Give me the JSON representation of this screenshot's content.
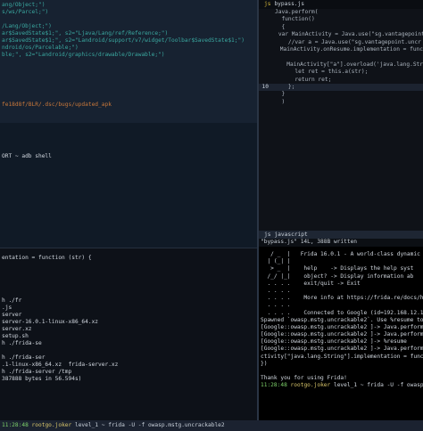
{
  "top_left": {
    "lines": [
      {
        "text": "ang/Object;\")",
        "color": "c-path"
      },
      {
        "text": "s/ws/Parcel;\")",
        "color": "c-path"
      },
      {
        "text": "",
        "color": "c-path"
      },
      {
        "text": "/Lang/Object;\")",
        "color": "c-path"
      },
      {
        "text": "ar$SavedState$1;\", s2=\"Ljava/Lang/ref/Reference;\")",
        "color": "c-path"
      },
      {
        "text": "ar$SavedState$1;\", s2=\"Landroid/support/v7/widget/Toolbar$SavedState$1;\")",
        "color": "c-path"
      },
      {
        "text": "ndroid/os/Parcelable;\")",
        "color": "c-path"
      },
      {
        "text": "ble;\", s2=\"Landroid/graphics/drawable/Drawable;\")",
        "color": "c-path"
      },
      {
        "text": "",
        "color": "c-path"
      },
      {
        "text": "",
        "color": "c-path"
      },
      {
        "text": "",
        "color": "c-path"
      },
      {
        "text": "",
        "color": "c-path"
      },
      {
        "text": "",
        "color": "c-path"
      },
      {
        "text": "",
        "color": "c-path"
      },
      {
        "text": "fe18d8f/BLR/.dsc/bugs/updated_apk",
        "color": "c-orange"
      }
    ]
  },
  "middle_left": {
    "lines": [
      {
        "text": "",
        "color": "c-grey"
      },
      {
        "text": "",
        "color": "c-grey"
      },
      {
        "text": "",
        "color": "c-grey"
      },
      {
        "text": "",
        "color": "c-grey"
      },
      {
        "text": "ORT ~ adb shell",
        "color": "c-white"
      }
    ]
  },
  "bottom_left": {
    "lines": [
      {
        "text": "",
        "color": "c-white"
      },
      {
        "text": "entation = function (str) {",
        "color": "c-white"
      },
      {
        "text": "",
        "color": "c-white"
      },
      {
        "text": "",
        "color": "c-white"
      },
      {
        "text": "",
        "color": "c-white"
      },
      {
        "text": "",
        "color": "c-white"
      },
      {
        "text": "",
        "color": "c-white"
      },
      {
        "text": "h ./fr",
        "color": "c-white"
      },
      {
        "text": ".js",
        "color": "c-white"
      },
      {
        "text": "server",
        "color": "c-white"
      },
      {
        "text": "server-16.0.1-linux-x86_64.xz",
        "color": "c-white"
      },
      {
        "text": "server.xz",
        "color": "c-white"
      },
      {
        "text": "setup.sh",
        "color": "c-white"
      },
      {
        "text": "h ./frida-se",
        "color": "c-white"
      },
      {
        "text": "",
        "color": "c-white"
      },
      {
        "text": "h ./frida-ser",
        "color": "c-white"
      },
      {
        "text": ".1-linux-x86_64.xz  frida-server.xz",
        "color": "c-white"
      },
      {
        "text": "h ./frida-server /tmp",
        "color": "c-white"
      },
      {
        "text": "387888 bytes in 56.594s)",
        "color": "c-white"
      }
    ]
  },
  "editor": {
    "tab_icon": "js",
    "tab_name": "bypass.js",
    "mode_icon": "js",
    "mode_name": "javascript",
    "status_file": "\"bypass.js\" 14L, 388B written",
    "lines": [
      {
        "num": "",
        "html_key": "l1"
      },
      {
        "num": "",
        "html_key": "l2"
      },
      {
        "num": "",
        "html_key": "l3"
      },
      {
        "num": "",
        "html_key": "l4"
      },
      {
        "num": "",
        "html_key": "l5"
      },
      {
        "num": "",
        "html_key": "l6"
      },
      {
        "num": "",
        "html_key": "l7"
      },
      {
        "num": "",
        "html_key": "l8"
      },
      {
        "num": "",
        "html_key": "l9"
      },
      {
        "num": "",
        "html_key": "l10"
      },
      {
        "num": "10",
        "html_key": "l11"
      },
      {
        "num": "",
        "html_key": "l12"
      },
      {
        "num": "",
        "html_key": "l13"
      },
      {
        "num": "",
        "html_key": "l14"
      }
    ],
    "code": {
      "l1": "Java.perform(",
      "l2": "  function()",
      "l3": "  {",
      "l4": "    var MainActivity = Java.use(\"sg.vantagepoint",
      "l5": "    //var a = Java.use(\"sg.vantagepoint.uncr",
      "l6": "    MainActivity.onResume.implementation = func",
      "l7": "",
      "l8": "      MainActivity[\"a\"].overload('java.lang.Str",
      "l9": "      let ret = this.a(str);",
      "l10": "      return ret;",
      "l11": "    };",
      "l12": "  }",
      "l13": "  )",
      "l14": ""
    }
  },
  "frida": {
    "logo": [
      "   / _  |   Frida 16.0.1 - A world-class dynamic",
      "  | (_| |",
      "   > _  |    help    -> Displays the help syst",
      "  /_/ |_|    object? -> Display information ab",
      "  . . . .    exit/quit -> Exit",
      "  . . . .",
      "  . . . .    More info at https://frida.re/docs/home",
      "  . . . .",
      "  . . . .    Connected to Google (id=192.168.12.190:",
      "Spawned `owasp.mstg.uncrackable2`. Use %resume to let",
      "[Google::owasp.mstg.uncrackable2 ]-> Java.perform(",
      "[Google::owasp.mstg.uncrackable2 ]-> Java.perform(",
      "[Google::owasp.mstg.uncrackable2 ]-> %resume",
      "[Google::owasp.mstg.uncrackable2 ]-> Java.perform(",
      "ctivity[\"java.lang.String\"].implementation = functio",
      "})",
      "",
      "Thank you for using Frida!"
    ],
    "prompt_time": "11:28:48",
    "prompt_user": "rootgo.joker",
    "prompt_rest": "level_1 ~ frida -U -f owasp.mst"
  },
  "tmux": {
    "time": "11:28:48",
    "host": "rootgo.joker",
    "rest": "level_1 ~ frida -U -f owasp.mstg.uncrackable2"
  }
}
